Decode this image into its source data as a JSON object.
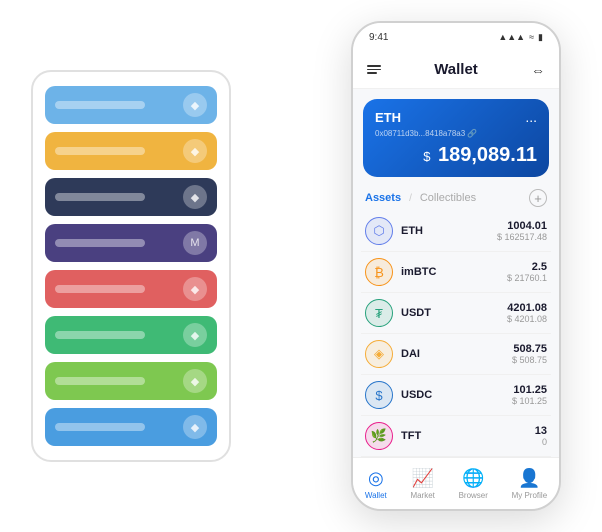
{
  "app": {
    "title": "Wallet",
    "status_bar": {
      "time": "9:41",
      "signal": "●●●",
      "wifi": "WiFi",
      "battery": "■"
    }
  },
  "card_stack": {
    "cards": [
      {
        "color": "#6db3e8",
        "icon": "◆"
      },
      {
        "color": "#f0b440",
        "icon": "◆"
      },
      {
        "color": "#2e3a59",
        "icon": "◆"
      },
      {
        "color": "#4a4080",
        "icon": "M"
      },
      {
        "color": "#e06060",
        "icon": "◆"
      },
      {
        "color": "#3fba75",
        "icon": "◆"
      },
      {
        "color": "#7ec850",
        "icon": "◆"
      },
      {
        "color": "#4a9de0",
        "icon": "◆"
      }
    ]
  },
  "eth_card": {
    "label": "ETH",
    "address": "0x08711d3b...8418a78a3",
    "address_suffix": "🔗",
    "balance_prefix": "$",
    "balance": "189,089.11",
    "menu_dots": "..."
  },
  "assets": {
    "tab_active": "Assets",
    "tab_separator": "/",
    "tab_inactive": "Collectibles",
    "add_label": "+",
    "items": [
      {
        "symbol": "ETH",
        "name": "ETH",
        "icon_color": "#627eea",
        "icon_char": "⬡",
        "amount": "1004.01",
        "usd": "$ 162517.48"
      },
      {
        "symbol": "imBTC",
        "name": "imBTC",
        "icon_color": "#f7931a",
        "icon_char": "₿",
        "amount": "2.5",
        "usd": "$ 21760.1"
      },
      {
        "symbol": "USDT",
        "name": "USDT",
        "icon_color": "#26a17b",
        "icon_char": "₮",
        "amount": "4201.08",
        "usd": "$ 4201.08"
      },
      {
        "symbol": "DAI",
        "name": "DAI",
        "icon_color": "#f5ac37",
        "icon_char": "◈",
        "amount": "508.75",
        "usd": "$ 508.75"
      },
      {
        "symbol": "USDC",
        "name": "USDC",
        "icon_color": "#2775ca",
        "icon_char": "$",
        "amount": "101.25",
        "usd": "$ 101.25"
      },
      {
        "symbol": "TFT",
        "name": "TFT",
        "icon_color": "#e91e8c",
        "icon_char": "🌿",
        "amount": "13",
        "usd": "0"
      }
    ]
  },
  "nav": {
    "items": [
      {
        "label": "Wallet",
        "icon": "◎",
        "active": true
      },
      {
        "label": "Market",
        "icon": "📈",
        "active": false
      },
      {
        "label": "Browser",
        "icon": "⊕",
        "active": false
      },
      {
        "label": "My Profile",
        "icon": "👤",
        "active": false
      }
    ]
  }
}
